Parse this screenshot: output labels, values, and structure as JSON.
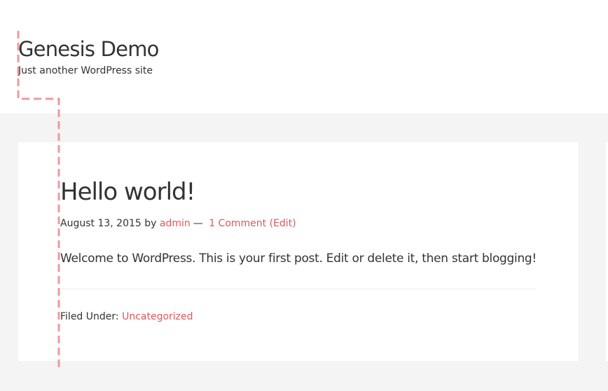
{
  "header": {
    "site_title": "Genesis Demo",
    "site_description": "Just another WordPress site"
  },
  "post": {
    "title": "Hello world!",
    "date": "August 13, 2015",
    "by_label": "by",
    "author": "admin",
    "separator": "—",
    "comments_link": "1 Comment",
    "edit_link": "(Edit)",
    "body": "Welcome to WordPress. This is your first post. Edit or delete it, then start blogging!",
    "filed_under_label": "Filed Under:",
    "category": "Uncategorized"
  },
  "colors": {
    "link": "#e0575c",
    "text": "#333333",
    "page_background": "#f4f4f4",
    "guide_line": "#ee9a9e"
  }
}
